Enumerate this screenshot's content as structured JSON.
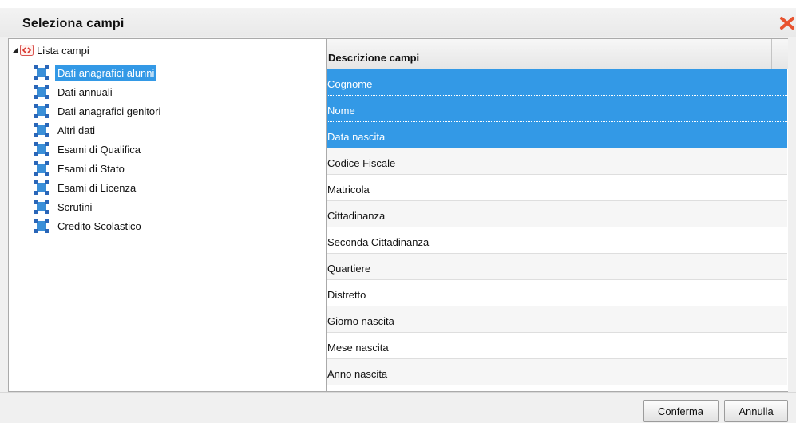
{
  "dialog": {
    "title": "Seleziona campi",
    "close_icon": "close-x-icon",
    "accent_color": "#3399e6",
    "close_color": "#e8532f"
  },
  "tree": {
    "root_label": "Lista campi",
    "root_icon": "code-tag-icon",
    "node_icon": "node-square-icon",
    "items": [
      {
        "label": "Dati anagrafici alunni",
        "selected": true
      },
      {
        "label": "Dati annuali",
        "selected": false
      },
      {
        "label": "Dati anagrafici genitori",
        "selected": false
      },
      {
        "label": "Altri dati",
        "selected": false
      },
      {
        "label": "Esami di Qualifica",
        "selected": false
      },
      {
        "label": "Esami di Stato",
        "selected": false
      },
      {
        "label": "Esami di Licenza",
        "selected": false
      },
      {
        "label": "Scrutini",
        "selected": false
      },
      {
        "label": "Credito Scolastico",
        "selected": false
      }
    ]
  },
  "grid": {
    "header": "Descrizione campi",
    "rows": [
      {
        "label": "Cognome",
        "selected": true
      },
      {
        "label": "Nome",
        "selected": true
      },
      {
        "label": "Data nascita",
        "selected": true
      },
      {
        "label": "Codice Fiscale",
        "selected": false
      },
      {
        "label": "Matricola",
        "selected": false
      },
      {
        "label": "Cittadinanza",
        "selected": false
      },
      {
        "label": "Seconda Cittadinanza",
        "selected": false
      },
      {
        "label": "Quartiere",
        "selected": false
      },
      {
        "label": "Distretto",
        "selected": false
      },
      {
        "label": "Giorno nascita",
        "selected": false
      },
      {
        "label": "Mese nascita",
        "selected": false
      },
      {
        "label": "Anno nascita",
        "selected": false
      }
    ]
  },
  "footer": {
    "confirm_label": "Conferma",
    "cancel_label": "Annulla"
  }
}
